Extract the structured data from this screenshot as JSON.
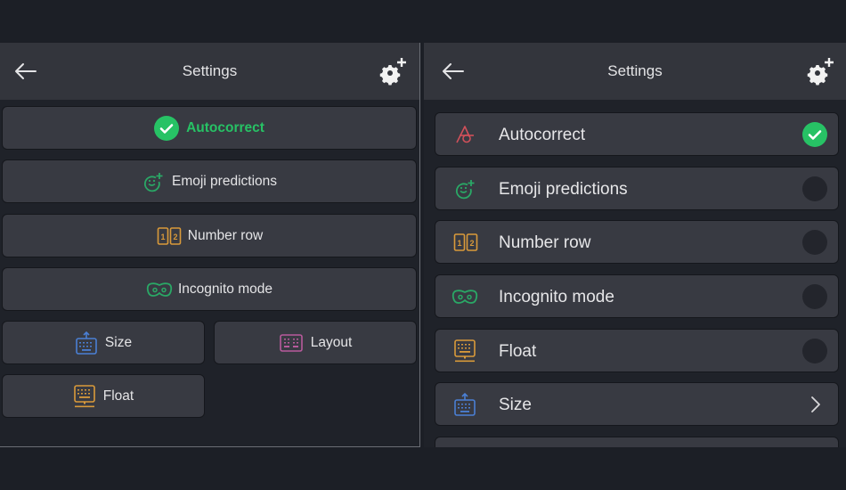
{
  "colors": {
    "accent_green": "#27c265",
    "header_bg": "#33353c",
    "button_bg": "#383a42",
    "icon_red": "#d0505a",
    "icon_green": "#2aa866",
    "icon_orange": "#d99a3a",
    "icon_blue": "#4a7fd4",
    "icon_pink": "#b85a9c"
  },
  "left_panel": {
    "header": {
      "title": "Settings",
      "back_icon": "arrow-left-icon",
      "settings_icon": "gear-plus-icon"
    },
    "buttons": [
      {
        "label": "Autocorrect",
        "icon": "check-circle-icon",
        "active": true
      },
      {
        "label": "Emoji predictions",
        "icon": "emoji-plus-icon",
        "active": false
      },
      {
        "label": "Number row",
        "icon": "number-row-icon",
        "active": false
      },
      {
        "label": "Incognito mode",
        "icon": "incognito-mask-icon",
        "active": false
      },
      {
        "label": "Size",
        "icon": "keyboard-resize-icon",
        "active": false
      },
      {
        "label": "Layout",
        "icon": "keyboard-layout-icon",
        "active": false
      },
      {
        "label": "Float",
        "icon": "keyboard-float-icon",
        "active": false
      }
    ]
  },
  "right_panel": {
    "header": {
      "title": "Settings",
      "back_icon": "arrow-left-icon",
      "settings_icon": "gear-plus-icon"
    },
    "rows": [
      {
        "label": "Autocorrect",
        "icon": "autocorrect-icon",
        "control": "toggle",
        "checked": true
      },
      {
        "label": "Emoji predictions",
        "icon": "emoji-plus-icon",
        "control": "toggle",
        "checked": false
      },
      {
        "label": "Number row",
        "icon": "number-row-icon",
        "control": "toggle",
        "checked": false
      },
      {
        "label": "Incognito mode",
        "icon": "incognito-mask-icon",
        "control": "toggle",
        "checked": false
      },
      {
        "label": "Float",
        "icon": "keyboard-float-icon",
        "control": "toggle",
        "checked": false
      },
      {
        "label": "Size",
        "icon": "keyboard-resize-icon",
        "control": "chevron"
      }
    ]
  }
}
